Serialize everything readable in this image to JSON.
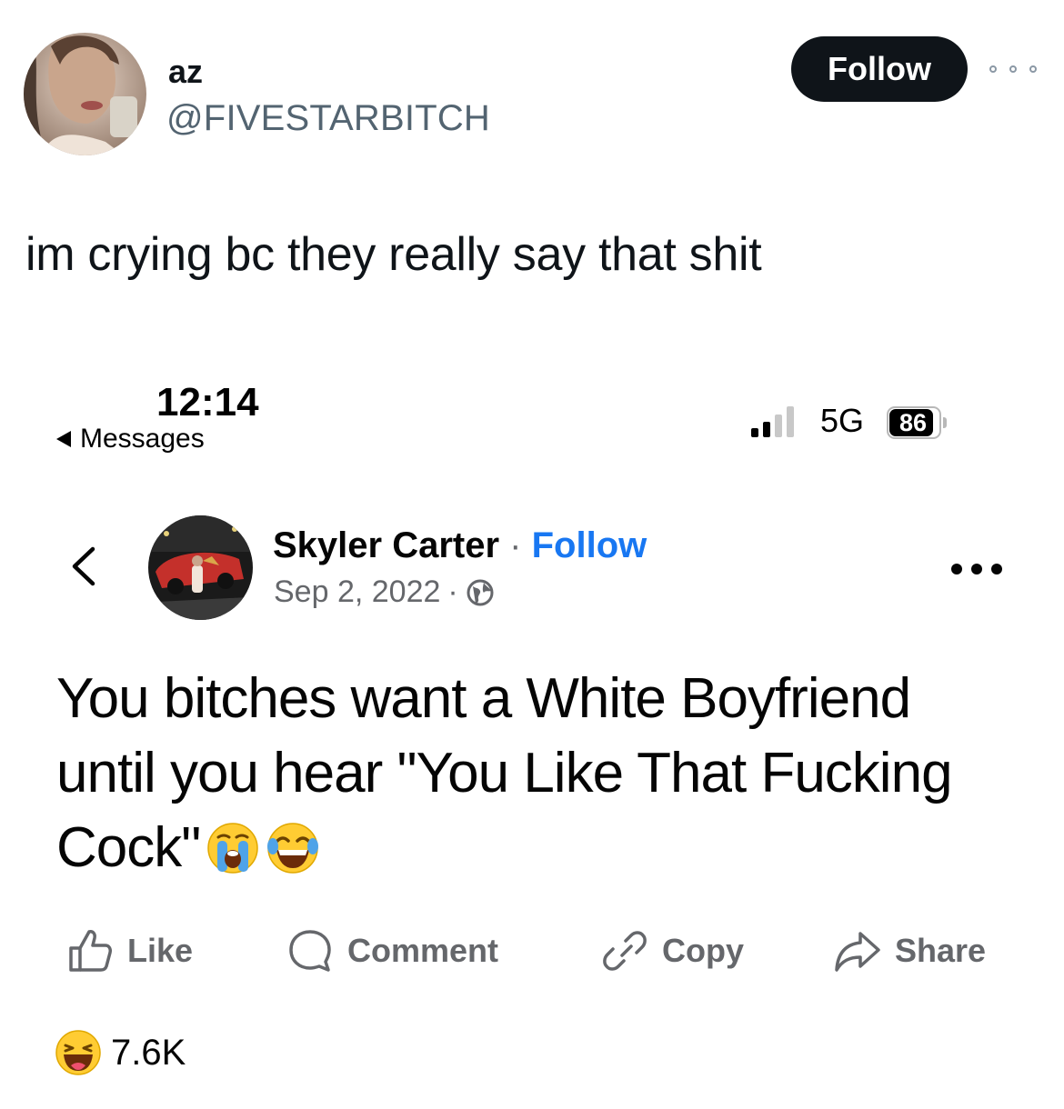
{
  "tweet": {
    "author_name": "az",
    "author_handle": "@FIVESTARBITCH",
    "follow_label": "Follow",
    "text": "im crying bc they really say that shit"
  },
  "embedded": {
    "status_bar": {
      "time": "12:14",
      "back_label": "Messages",
      "network": "5G",
      "battery": "86"
    },
    "post": {
      "author_name": "Skyler Carter",
      "separator": "·",
      "follow_label": "Follow",
      "date": "Sep 2, 2022",
      "date_separator": "·",
      "text": "You bitches want a White Boyfriend until you hear \"You Like That Fucking Cock\"",
      "emojis": [
        "loudly-crying-face",
        "face-with-tears-of-joy"
      ]
    },
    "actions": {
      "like": "Like",
      "comment": "Comment",
      "copy": "Copy",
      "share": "Share"
    },
    "reactions": {
      "icon": "haha-reaction",
      "count": "7.6K"
    }
  },
  "colors": {
    "follow_button_bg": "#0f1419",
    "handle_gray": "#536471",
    "fb_blue": "#1877f2",
    "fb_gray": "#65676b"
  }
}
